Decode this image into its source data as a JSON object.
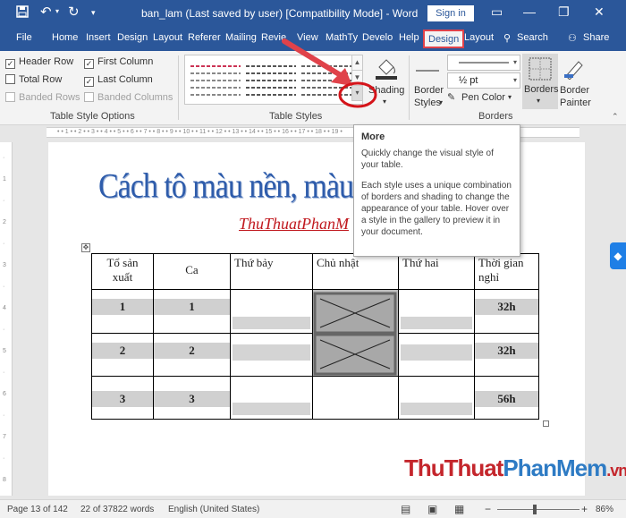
{
  "titlebar": {
    "title": "ban_lam (Last saved by user) [Compatibility Mode]  -  Word",
    "sign_in": "Sign in",
    "icons": [
      "save-icon",
      "undo-icon",
      "redo-icon",
      "customize-icon"
    ],
    "minimize": "—",
    "restore": "❐",
    "close": "✕"
  },
  "tabs": [
    "File",
    "Home",
    "Insert",
    "Design",
    "Layout",
    "Referer",
    "Mailing",
    "Revie",
    "View",
    "MathTy",
    "Develo",
    "Help",
    "Design",
    "Layout",
    "Search",
    "Share"
  ],
  "ribbon": {
    "style_options": {
      "header_row": "Header Row",
      "first_column": "First Column",
      "total_row": "Total Row",
      "last_column": "Last Column",
      "banded_rows": "Banded Rows",
      "banded_columns": "Banded Columns",
      "label": "Table Style Options"
    },
    "table_styles_label": "Table Styles",
    "shading": "Shading",
    "border_styles": "Border\nStyles",
    "border_styles_l1": "Border",
    "border_styles_l2": "Styles",
    "line_weight": "½ pt",
    "pen_color": "Pen Color",
    "borders": "Borders",
    "border_painter_l1": "Border",
    "border_painter_l2": "Painter",
    "borders_label": "Borders"
  },
  "tooltip": {
    "title": "More",
    "line1": "Quickly change the visual style of your table.",
    "line2": "Each style uses a unique combination of borders and shading to change the appearance of your table. Hover over a style in the gallery to preview it in your document."
  },
  "document": {
    "heading": "Cách tô màu nền,  màu bảng",
    "subheading": "ThuThuatPhanM",
    "table": {
      "headers": [
        "Tổ sản xuất",
        "Ca",
        "Thứ bảy",
        "Chủ nhật",
        "Thứ hai",
        "Thời gian nghỉ"
      ],
      "rows": [
        {
          "to": "1",
          "ca": "1",
          "nghi": "32h"
        },
        {
          "to": "2",
          "ca": "2",
          "nghi": "32h"
        },
        {
          "to": "3",
          "ca": "3",
          "nghi": "56h"
        }
      ]
    }
  },
  "watermark": {
    "part1": "ThuThuat",
    "part2": "PhanMem",
    "part3": ".vn"
  },
  "statusbar": {
    "page": "Page 13 of 142",
    "words": "22 of 37822 words",
    "language": "English (United States)",
    "zoom": "86%"
  },
  "colors": {
    "accent": "#2b579a",
    "highlight_red": "#e0424a",
    "heading_blue": "#2e5cab",
    "subheading_red": "#c0171d"
  }
}
